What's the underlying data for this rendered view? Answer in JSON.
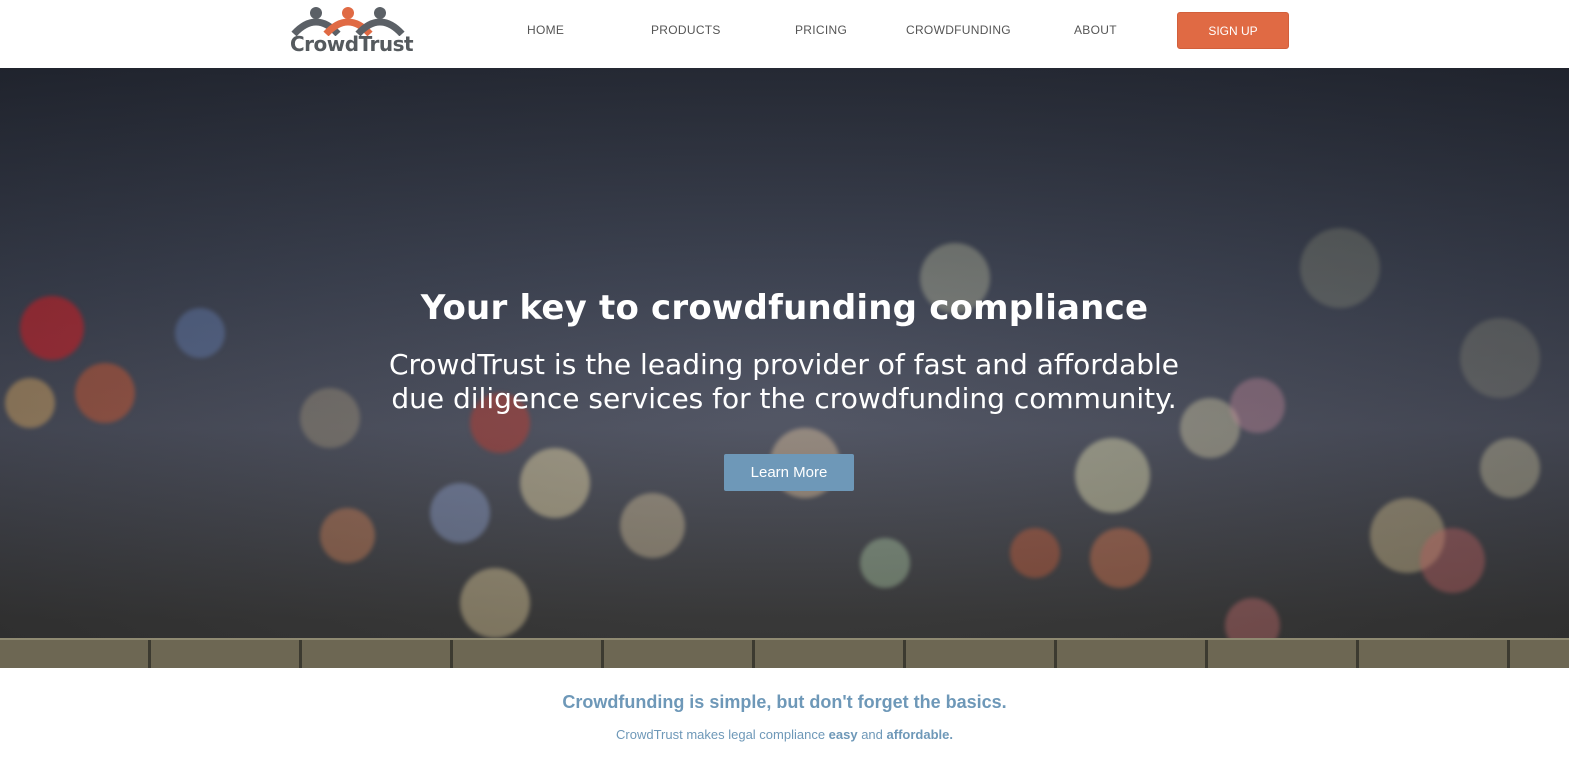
{
  "header": {
    "logo_text": "CrowdTrust",
    "nav": [
      {
        "label": "HOME"
      },
      {
        "label": "PRODUCTS"
      },
      {
        "label": "PRICING"
      },
      {
        "label": "CROWDFUNDING"
      },
      {
        "label": "ABOUT"
      }
    ],
    "signup_label": "SIGN UP"
  },
  "hero": {
    "title": "Your key to crowdfunding compliance",
    "subtitle": "CrowdTrust is the leading provider of fast and affordable due diligence services for the crowdfunding community.",
    "button_label": "Learn More"
  },
  "intro": {
    "tagline": "Crowdfunding is simple, but don't forget the basics.",
    "sub_prefix": "CrowdTrust makes legal compliance ",
    "sub_easy": "easy",
    "sub_and": " and ",
    "sub_affordable": "affordable."
  },
  "colors": {
    "accent_orange": "#e06a44",
    "accent_blue": "#6e98b8",
    "logo_grey": "#555a5e"
  }
}
